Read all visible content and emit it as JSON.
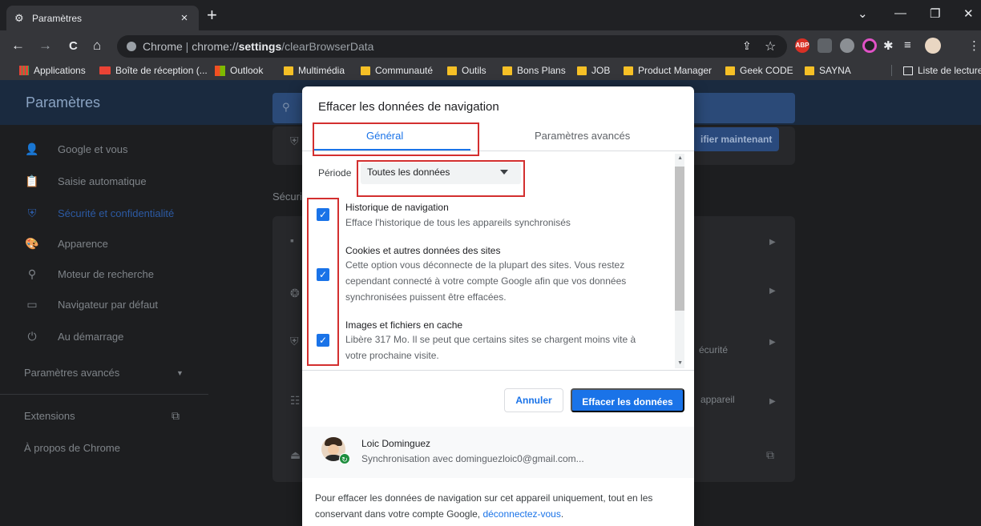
{
  "tab": {
    "title": "Paramètres",
    "close": "×",
    "new": "+"
  },
  "window_controls": {
    "menu": "⌄",
    "minimize": "—",
    "restore": "❐",
    "close": "✕"
  },
  "toolbar": {
    "back": "←",
    "forward": "→",
    "reload": "C",
    "home": "⌂",
    "url_site": "Chrome",
    "url_sep": " | ",
    "url_host": "chrome://",
    "url_path": "settings",
    "url_path2": "/clearBrowserData",
    "share": "⇪",
    "star": "☆",
    "menu": "⋮",
    "extensions": [
      "ABP",
      "",
      "",
      "",
      "",
      ""
    ]
  },
  "bookmarks": [
    {
      "label": "Applications",
      "kind": "apps"
    },
    {
      "label": "Boîte de réception (...",
      "kind": "gmail"
    },
    {
      "label": "Outlook",
      "kind": "ms"
    },
    {
      "label": "Multimédia",
      "kind": "folder"
    },
    {
      "label": "Communauté",
      "kind": "folder"
    },
    {
      "label": "Outils",
      "kind": "folder"
    },
    {
      "label": "Bons Plans",
      "kind": "folder"
    },
    {
      "label": "JOB",
      "kind": "folder"
    },
    {
      "label": "Product Manager",
      "kind": "folder"
    },
    {
      "label": "Geek CODE",
      "kind": "folder"
    },
    {
      "label": "SAYNA",
      "kind": "folder"
    },
    {
      "label": "Liste de lecture",
      "kind": "reading"
    }
  ],
  "settings": {
    "title": "Paramètres",
    "sidebar": [
      {
        "label": "Google et vous",
        "icon": "person-icon",
        "glyph": "👤",
        "active": false
      },
      {
        "label": "Saisie automatique",
        "icon": "clipboard-icon",
        "glyph": "📋",
        "active": false
      },
      {
        "label": "Sécurité et confidentialité",
        "icon": "shield-icon",
        "glyph": "⛨",
        "active": true
      },
      {
        "label": "Apparence",
        "icon": "palette-icon",
        "glyph": "🎨",
        "active": false
      },
      {
        "label": "Moteur de recherche",
        "icon": "search-icon",
        "glyph": "⚲",
        "active": false
      },
      {
        "label": "Navigateur par défaut",
        "icon": "browser-icon",
        "glyph": "▭",
        "active": false
      },
      {
        "label": "Au démarrage",
        "icon": "power-icon",
        "glyph": "⏻",
        "active": false
      }
    ],
    "advanced": "Paramètres avancés",
    "extensions": "Extensions",
    "about": "À propos de Chrome",
    "bg_section": "Sécuri",
    "bg_button": "ifier maintenant",
    "bg_row_security": "écurité",
    "bg_row_device": "appareil"
  },
  "dialog": {
    "title": "Effacer les données de navigation",
    "tabs": {
      "general": "Général",
      "advanced": "Paramètres avancés"
    },
    "period_label": "Période",
    "period_value": "Toutes les données",
    "options": [
      {
        "title": "Historique de navigation",
        "desc": "Efface l'historique de tous les appareils synchronisés",
        "checked": true
      },
      {
        "title": "Cookies et autres données des sites",
        "desc": "Cette option vous déconnecte de la plupart des sites. Vous restez cependant connecté à votre compte Google afin que vos données synchronisées puissent être effacées.",
        "checked": true
      },
      {
        "title": "Images et fichiers en cache",
        "desc": "Libère 317 Mo. Il se peut que certains sites se chargent moins vite à votre prochaine visite.",
        "checked": true
      }
    ],
    "cancel": "Annuler",
    "clear": "Effacer les données",
    "account": {
      "name": "Loic Dominguez",
      "sync": "Synchronisation avec dominguezloic0@gmail.com..."
    },
    "note_text": "Pour effacer les données de navigation sur cet appareil uniquement, tout en les conservant dans votre compte Google, ",
    "note_link": "déconnectez-vous",
    "note_end": "."
  },
  "colors": {
    "accent": "#1a73e8",
    "highlight_frame": "#d32f2f",
    "chrome_dark": "#202124"
  }
}
